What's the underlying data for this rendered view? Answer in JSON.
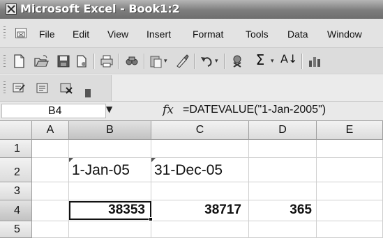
{
  "window": {
    "title": "Microsoft Excel - Book1:2"
  },
  "menu": {
    "items": [
      "File",
      "Edit",
      "View",
      "Insert",
      "Format",
      "Tools",
      "Data",
      "Window"
    ]
  },
  "toolbar": {
    "standard_icons": [
      "new-icon",
      "open-icon",
      "save-icon",
      "permission-icon",
      "print-icon",
      "print-preview-icon",
      "research-icon",
      "paste-icon",
      "format-painter-icon",
      "undo-icon",
      "hyperlink-icon",
      "autosum-icon",
      "sort-ascending-icon"
    ],
    "sigma_glyph": "Σ",
    "sort_glyph": "A↓"
  },
  "formula_bar": {
    "name_box": "B4",
    "fx_label": "fx",
    "formula": "=DATEVALUE(\"1-Jan-2005\")"
  },
  "sheet": {
    "columns": [
      "A",
      "B",
      "C",
      "D",
      "E"
    ],
    "rows": [
      "1",
      "2",
      "3",
      "4",
      "5"
    ],
    "active_cell": "B4",
    "cells": {
      "B2": "1-Jan-05",
      "C2": "31-Dec-05",
      "B4": "38353",
      "C4": "38717",
      "D4": "365"
    }
  }
}
